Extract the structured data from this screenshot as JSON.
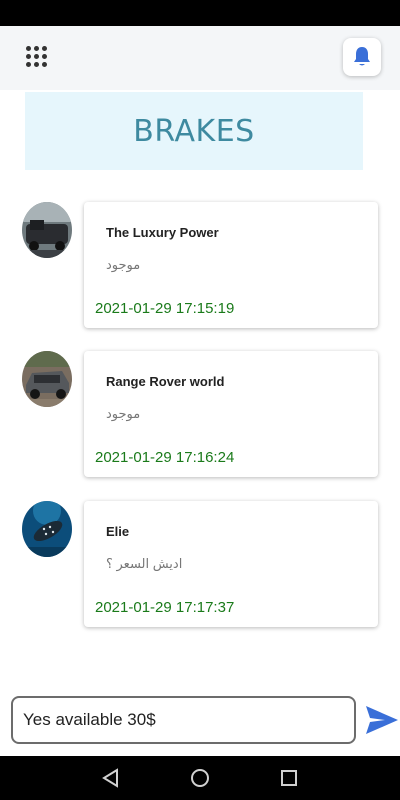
{
  "header": {
    "menu_icon": "grid-icon",
    "notification_icon": "bell-icon",
    "accent": "#3a6fd8"
  },
  "banner": {
    "text": "BRAKES"
  },
  "messages": [
    {
      "name": "The Luxury Power",
      "text": "موجود",
      "time": "2021-01-29 17:15:19"
    },
    {
      "name": "Range Rover world",
      "text": "موجود",
      "time": "2021-01-29 17:16:24"
    },
    {
      "name": "Elie",
      "text": "اديش السعر ؟",
      "time": "2021-01-29 17:17:37"
    }
  ],
  "composer": {
    "value": "Yes available 30$",
    "send_icon": "send-icon"
  },
  "navigation": {
    "back_icon": "back-icon",
    "home_icon": "home-icon",
    "recents_icon": "recents-icon"
  },
  "colors": {
    "timestamp": "#1a7a1a",
    "send": "#3a6fd8"
  }
}
